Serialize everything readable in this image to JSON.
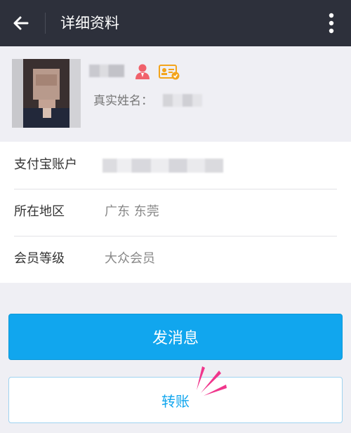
{
  "header": {
    "title": "详细资料",
    "back_icon": "arrow-left-icon",
    "more_icon": "more-vertical-icon"
  },
  "profile": {
    "realname_label": "真实姓名：",
    "icons": [
      "person-icon",
      "id-card-verified-icon"
    ],
    "colors": {
      "person": "#f0616b",
      "card": "#f3a41b"
    }
  },
  "info": {
    "rows": [
      {
        "label": "支付宝账户",
        "value": ""
      },
      {
        "label": "所在地区",
        "value": "广东 东莞"
      },
      {
        "label": "会员等级",
        "value": "大众会员"
      }
    ]
  },
  "actions": {
    "send_message": "发消息",
    "transfer": "转账"
  },
  "colors": {
    "header_bg": "#2d303b",
    "primary": "#11a6ee",
    "accent_burst": "#f0368c"
  }
}
